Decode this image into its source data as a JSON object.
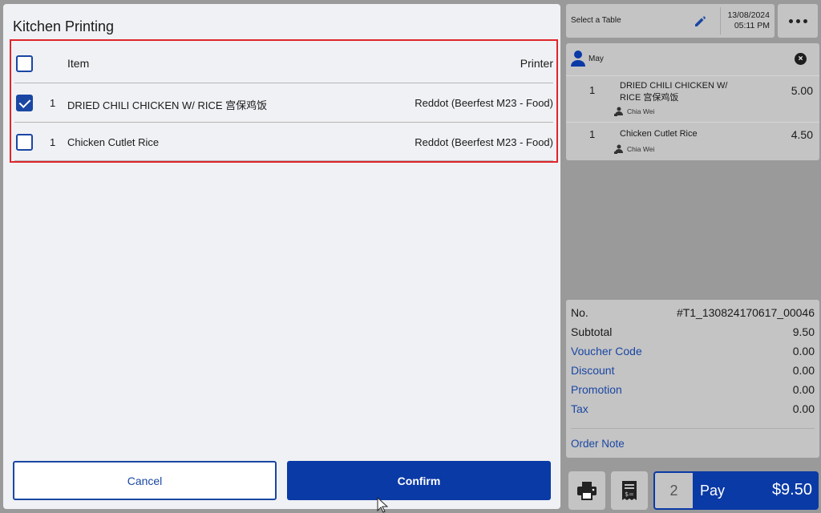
{
  "modal": {
    "title": "Kitchen Printing",
    "header": {
      "item_label": "Item",
      "printer_label": "Printer",
      "select_all_checked": false
    },
    "rows": [
      {
        "checked": true,
        "qty": "1",
        "name": "DRIED CHILI CHICKEN W/ RICE 宫保鸡饭",
        "printer": "Reddot (Beerfest M23 - Food)"
      },
      {
        "checked": false,
        "qty": "1",
        "name": "Chicken Cutlet Rice",
        "printer": "Reddot (Beerfest M23 - Food)"
      }
    ],
    "cancel_label": "Cancel",
    "confirm_label": "Confirm"
  },
  "topbar": {
    "table_label": "Select a Table",
    "date": "13/08/2024",
    "time": "05:11 PM",
    "pencil_icon": "pencil-icon",
    "more_icon": "more-dots-icon"
  },
  "order": {
    "customer": "May",
    "items": [
      {
        "qty": "1",
        "name": "DRIED CHILI CHICKEN W/ RICE 宫保鸡饭",
        "price": "5.00",
        "staff": "Chia Wei"
      },
      {
        "qty": "1",
        "name": "Chicken Cutlet Rice",
        "price": "4.50",
        "staff": "Chia Wei"
      }
    ]
  },
  "summary": {
    "no_label": "No.",
    "no_value": "#T1_130824170617_00046",
    "subtotal_label": "Subtotal",
    "subtotal_value": "9.50",
    "voucher_label": "Voucher Code",
    "voucher_value": "0.00",
    "discount_label": "Discount",
    "discount_value": "0.00",
    "promotion_label": "Promotion",
    "promotion_value": "0.00",
    "tax_label": "Tax",
    "tax_value": "0.00",
    "order_note_label": "Order Note"
  },
  "footer": {
    "print_icon": "printer-icon",
    "receipt_icon": "receipt-icon",
    "pay_count": "2",
    "pay_label": "Pay",
    "pay_amount": "$9.50"
  },
  "colors": {
    "accent": "#0a3aa6",
    "highlight": "#e0252b"
  }
}
